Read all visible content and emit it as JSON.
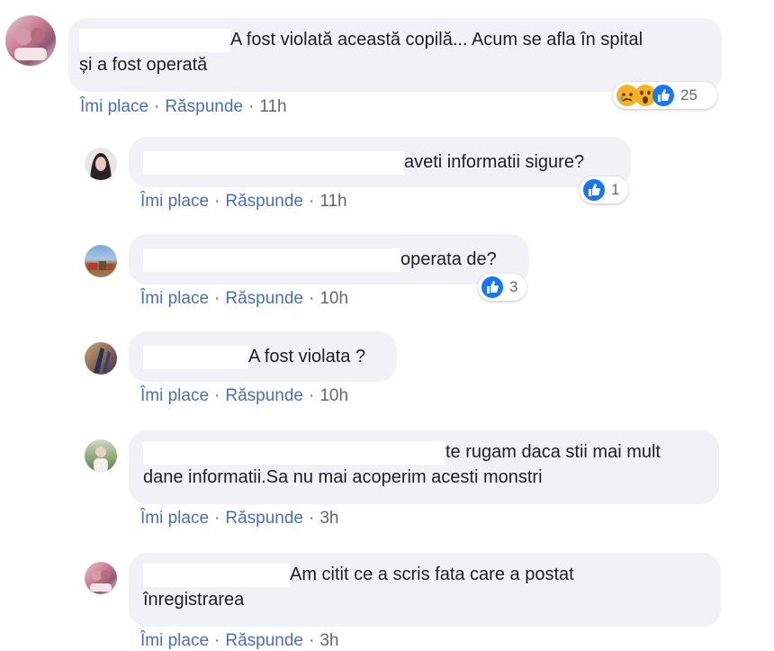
{
  "actions": {
    "like": "Îmi place",
    "reply": "Răspunde",
    "separator": "·"
  },
  "comments": [
    {
      "text": "A fost violată această copilă... Acum se afla în spital și a fost operată",
      "line1": "A fost violată această copilă... Acum se afla în spital",
      "line2": "și a fost operată",
      "time": "11h",
      "reactions": {
        "icons": [
          "sad-icon",
          "wow-icon",
          "like-icon"
        ],
        "count": "25"
      }
    },
    {
      "text": "aveti informatii sigure?",
      "time": "11h",
      "reactions": {
        "icons": [
          "like-icon"
        ],
        "count": "1"
      }
    },
    {
      "text": "operata de?",
      "time": "10h",
      "reactions": {
        "icons": [
          "like-icon"
        ],
        "count": "3"
      }
    },
    {
      "text": "A fost violata ?",
      "time": "10h"
    },
    {
      "line1": "te rugam daca stii mai mult",
      "line2": "dane informatii.Sa nu mai acoperim acesti monstri",
      "time": "3h"
    },
    {
      "line1": "Am citit ce a scris fata care a postat",
      "line2": "înregistrarea",
      "time": "3h"
    }
  ],
  "colors": {
    "like_blue": "#1877f2",
    "link": "#4a6fb5",
    "bubble": "#f0f2f5",
    "meta": "#65676b"
  }
}
